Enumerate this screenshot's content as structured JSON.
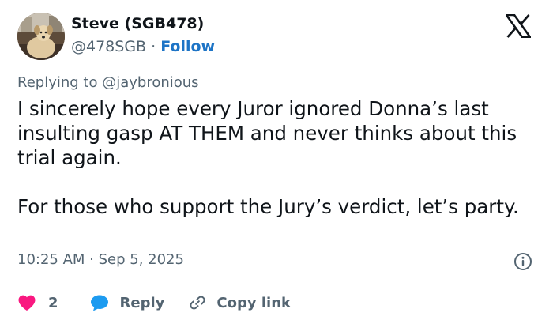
{
  "author": {
    "name": "Steve (SGB478)",
    "handle": "@478SGB",
    "separator": " · ",
    "follow_label": "Follow",
    "avatar_icon": "dog-avatar-photo"
  },
  "brand": {
    "logo_icon": "x-logo-icon"
  },
  "reply_context": {
    "prefix": "Replying to ",
    "handle": "@jaybronious"
  },
  "tweet": {
    "paragraph_1": "I sincerely hope every Juror ignored Donna’s last insulting gasp AT THEM and never thinks about this trial again.",
    "paragraph_2": "For those who support the Jury’s verdict, let’s party."
  },
  "meta": {
    "timestamp": "10:25 AM · Sep 5, 2025",
    "info_icon": "info-icon"
  },
  "actions": {
    "like_count": "2",
    "reply_label": "Reply",
    "copy_label": "Copy link"
  },
  "colors": {
    "text": "#0f1419",
    "muted": "#536471",
    "follow": "#1d74c6",
    "heart": "#f91880",
    "reply_bubble": "#1d9bf0",
    "divider": "#e1e8ed"
  }
}
